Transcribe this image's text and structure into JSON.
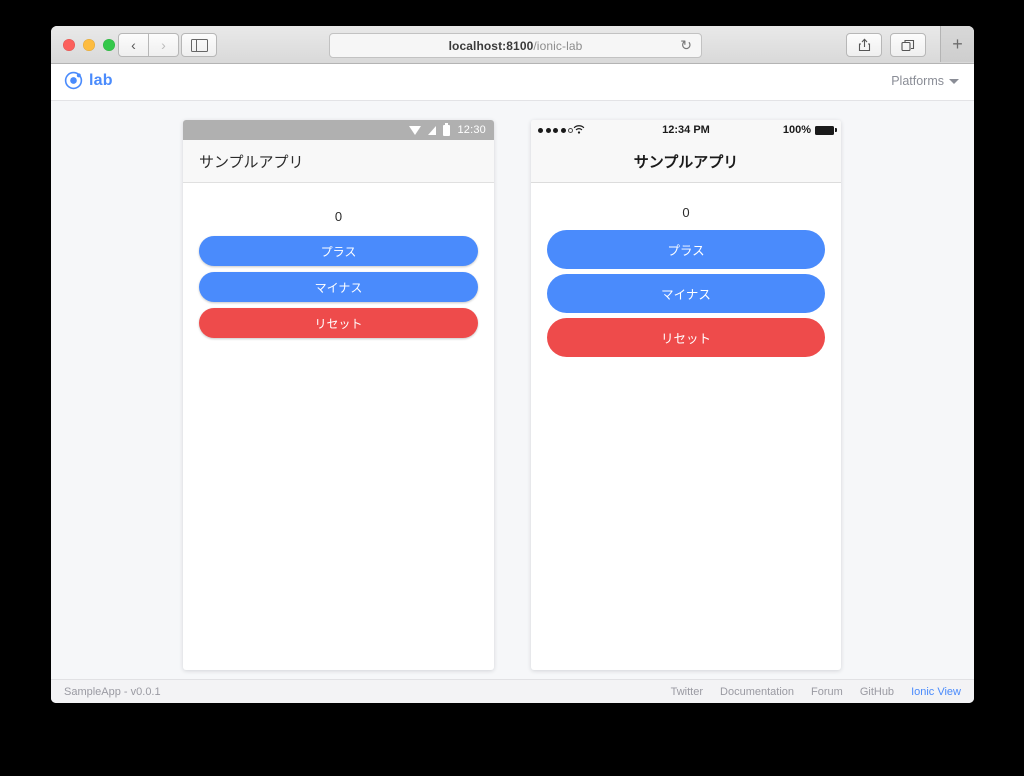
{
  "browser": {
    "traffic_lights": [
      "close",
      "minimize",
      "zoom"
    ],
    "back_label": "‹",
    "forward_label": "›",
    "url_host": "localhost:8100",
    "url_path": "/ionic-lab",
    "reload_label": "↻",
    "new_tab_label": "+"
  },
  "lab_header": {
    "brand": "lab",
    "platforms_label": "Platforms"
  },
  "devices": [
    {
      "platform": "android",
      "status_bar": {
        "time": "12:30"
      },
      "nav_title": "サンプルアプリ",
      "counter": "0",
      "buttons": [
        {
          "label": "プラス",
          "color": "#4a8bfc",
          "style": "blue"
        },
        {
          "label": "マイナス",
          "color": "#4a8bfc",
          "style": "blue"
        },
        {
          "label": "リセット",
          "color": "#ee4b4b",
          "style": "red"
        }
      ]
    },
    {
      "platform": "ios",
      "status_bar": {
        "time": "12:34 PM",
        "battery_pct": "100%"
      },
      "nav_title": "サンプルアプリ",
      "counter": "0",
      "buttons": [
        {
          "label": "プラス",
          "color": "#4a8bfc",
          "style": "blue"
        },
        {
          "label": "マイナス",
          "color": "#4a8bfc",
          "style": "blue"
        },
        {
          "label": "リセット",
          "color": "#ee4b4b",
          "style": "red"
        }
      ]
    }
  ],
  "footer": {
    "app_version": "SampleApp - v0.0.1",
    "links": [
      {
        "label": "Twitter",
        "accent": false
      },
      {
        "label": "Documentation",
        "accent": false
      },
      {
        "label": "Forum",
        "accent": false
      },
      {
        "label": "GitHub",
        "accent": false
      },
      {
        "label": "Ionic View",
        "accent": true
      }
    ]
  },
  "colors": {
    "accent_blue": "#4a8bfc",
    "danger_red": "#ee4b4b",
    "muted_text": "#9a9aa2",
    "android_status_bg": "#b0b0b0"
  }
}
